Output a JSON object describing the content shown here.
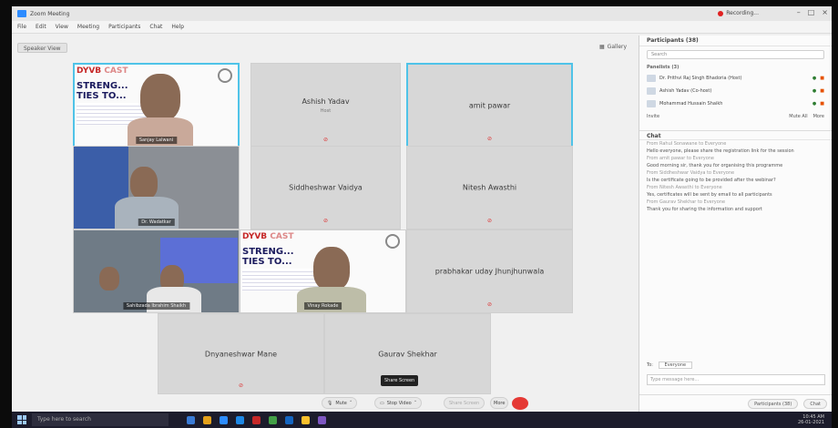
{
  "window": {
    "title": "Zoom Meeting",
    "recording": "Recording..."
  },
  "menu": [
    "File",
    "Edit",
    "View",
    "Meeting",
    "Participants",
    "Chat",
    "Help"
  ],
  "controls": {
    "speaker_view": "Speaker View",
    "layout": "Gallery"
  },
  "tiles": [
    {
      "name": "Ashish Yadav",
      "sub": "Host"
    },
    {
      "name": "amit pawar"
    },
    {
      "name": "Siddheshwar Vaidya"
    },
    {
      "name": "Nitesh Awasthi"
    },
    {
      "name": "prabhakar uday Jhunjhunwala"
    },
    {
      "name": "Dnyaneshwar Mane"
    },
    {
      "name": "Gaurav Shekhar"
    }
  ],
  "slide": {
    "brand_a": "DYVB",
    "brand_b": "CAST",
    "headline_1": "STRENG...",
    "headline_2": "TIES TO..."
  },
  "video_labels": {
    "v1": "Sanjay Lalwani",
    "v2": "Dr. Wadatkar",
    "v3": "Sahibzada Ibrahim Shaikh",
    "v4": "Vinay Rokade"
  },
  "tooltip": "Share Screen",
  "toolbar": {
    "mute": "Mute",
    "stop_video": "Stop Video",
    "share": "Share Screen",
    "more": "More"
  },
  "panel": {
    "title": "Participants (38)",
    "search_placeholder": "Search",
    "section": "Panelists (3)",
    "participants": [
      {
        "name": "Dr. Prithvi Raj Singh Bhadoria",
        "role": "Host"
      },
      {
        "name": "Ashish Yadav",
        "role": "Co-host"
      },
      {
        "name": "Mohammad Hussain Shaikh"
      }
    ],
    "invite": "Invite",
    "mute_all": "Mute All",
    "more": "More",
    "chat_title": "Chat",
    "chat": [
      {
        "meta": "From Rahul Sonawane to Everyone",
        "text": "Hello everyone, please share the registration link for the session"
      },
      {
        "meta": "From amit pawar to Everyone",
        "text": "Good morning sir, thank you for organising this programme"
      },
      {
        "meta": "From Siddheshwar Vaidya to Everyone",
        "text": "Is the certificate going to be provided after the webinar?"
      },
      {
        "meta": "From Nitesh Awasthi to Everyone",
        "text": "Yes, certificates will be sent by email to all participants"
      },
      {
        "meta": "From Gaurav Shekhar to Everyone",
        "text": "Thank you for sharing the information and support"
      }
    ],
    "to_label": "To:",
    "to_value": "Everyone",
    "message_placeholder": "Type message here..."
  },
  "taskbar": {
    "search": "Type here to search",
    "time": "10:45 AM",
    "date": "26-01-2021"
  }
}
